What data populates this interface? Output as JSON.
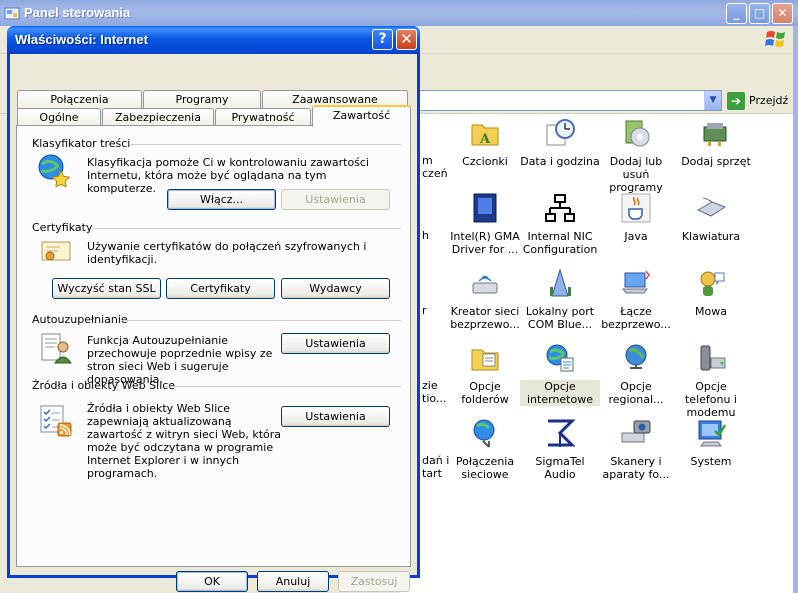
{
  "background_window": {
    "title": "Panel sterowania",
    "address_go_label": "Przejdź"
  },
  "control_panel_items": [
    {
      "label": "Czcionki",
      "icon": "fonts-folder-icon"
    },
    {
      "label": "Data i godzina",
      "icon": "clock-icon"
    },
    {
      "label": "Dodaj lub usuń programy",
      "icon": "add-remove-programs-icon"
    },
    {
      "label": "Dodaj sprzęt",
      "icon": "add-hardware-icon"
    },
    {
      "label": "Intel(R) GMA Driver for ...",
      "icon": "intel-gma-icon"
    },
    {
      "label": "Internal NIC Configuration",
      "icon": "network-icon"
    },
    {
      "label": "Java",
      "icon": "java-cup-icon"
    },
    {
      "label": "Klawiatura",
      "icon": "keyboard-icon"
    },
    {
      "label": "Kreator sieci bezprzewo...",
      "icon": "wireless-wizard-icon"
    },
    {
      "label": "Lokalny port COM Blue...",
      "icon": "bluetooth-com-icon"
    },
    {
      "label": "Łącze bezprzewo...",
      "icon": "wireless-link-icon"
    },
    {
      "label": "Mowa",
      "icon": "speech-icon"
    },
    {
      "label": "Opcje folderów",
      "icon": "folder-options-icon"
    },
    {
      "label": "Opcje internetowe",
      "icon": "internet-options-icon"
    },
    {
      "label": "Opcje regional...",
      "icon": "globe-icon"
    },
    {
      "label": "Opcje telefonu i modemu",
      "icon": "phone-modem-icon"
    },
    {
      "label": "Połączenia sieciowe",
      "icon": "network-connections-icon"
    },
    {
      "label": "SigmaTel Audio",
      "icon": "sigmatel-icon"
    },
    {
      "label": "Skanery i aparaty fo...",
      "icon": "scanner-camera-icon"
    },
    {
      "label": "System",
      "icon": "system-icon"
    }
  ],
  "cut_labels": [
    "m",
    "czeń",
    "h",
    "r",
    "zie",
    "tio...",
    "dań i",
    "tart"
  ],
  "dialog": {
    "title": "Właściwości: Internet",
    "help": "?",
    "close": "✕",
    "tabs_row1": [
      "Połączenia",
      "Programy",
      "Zaawansowane"
    ],
    "tabs_row2": [
      "Ogólne",
      "Zabezpieczenia",
      "Prywatność",
      "Zawartość"
    ],
    "active_tab": "Zawartość",
    "groups": {
      "content_advisor": {
        "title": "Klasyfikator treści",
        "description": "Klasyfikacja pomoże Ci w kontrolowaniu zawartości Internetu, która może być oglądana na tym komputerze.",
        "enable_button": "Włącz...",
        "settings_button": "Ustawienia"
      },
      "certificates": {
        "title": "Certyfikaty",
        "description": "Używanie certyfikatów do połączeń szyfrowanych i identyfikacji.",
        "clear_ssl_button": "Wyczyść stan SSL",
        "certificates_button": "Certyfikaty",
        "publishers_button": "Wydawcy"
      },
      "autocomplete": {
        "title": "Autouzupełnianie",
        "description": "Funkcja Autouzupełnianie przechowuje poprzednie wpisy ze stron sieci Web i sugeruje dopasowania.",
        "settings_button": "Ustawienia"
      },
      "feeds": {
        "title": "Źródła i obiekty Web Slice",
        "description": "Źródła i obiekty Web Slice zapewniają aktualizowaną zawartość z witryn sieci Web, która może być odczytana w programie Internet Explorer i w innych programach.",
        "settings_button": "Ustawienia"
      }
    },
    "buttons": {
      "ok": "OK",
      "cancel": "Anuluj",
      "apply": "Zastosuj"
    }
  },
  "colors": {
    "dialog_title_blue": "#0a5ff1",
    "active_tab_accent": "#ffc83d",
    "close_red": "#c8401f"
  }
}
